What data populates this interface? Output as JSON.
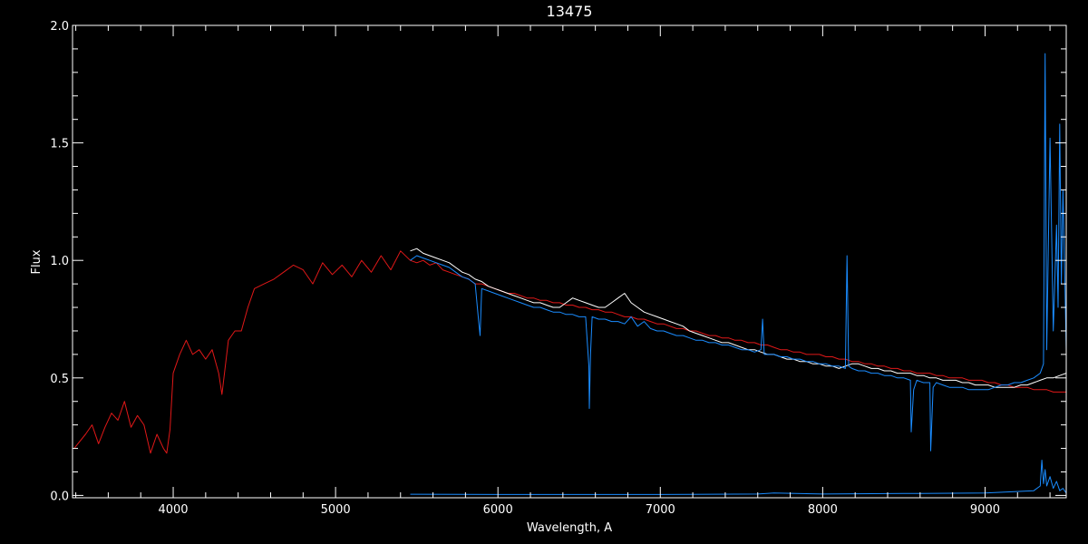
{
  "chart_data": {
    "type": "line",
    "title": "13475",
    "xlabel": "Wavelength, A",
    "ylabel": "Flux",
    "xlim": [
      3380,
      9500
    ],
    "ylim": [
      -0.01,
      2.0
    ],
    "grid": false,
    "legend": "none",
    "background": "#000000",
    "axis_color": "#ffffff",
    "x_ticks": [
      4000,
      5000,
      6000,
      7000,
      8000,
      9000
    ],
    "y_ticks": [
      0.0,
      0.5,
      1.0,
      1.5,
      2.0
    ],
    "x_tick_labels": [
      "4000",
      "5000",
      "6000",
      "7000",
      "8000",
      "9000"
    ],
    "y_tick_labels": [
      "0.0",
      "0.5",
      "1.0",
      "1.5",
      "2.0"
    ],
    "series": [
      {
        "color": "#e01818",
        "role": "model",
        "x": [
          3390,
          3460,
          3500,
          3540,
          3580,
          3620,
          3660,
          3700,
          3740,
          3780,
          3820,
          3860,
          3900,
          3940,
          3960,
          3980,
          4000,
          4040,
          4080,
          4120,
          4160,
          4200,
          4240,
          4280,
          4300,
          4340,
          4380,
          4420,
          4460,
          4500,
          4560,
          4620,
          4680,
          4740,
          4800,
          4860,
          4920,
          4980,
          5040,
          5100,
          5160,
          5220,
          5280,
          5340,
          5400,
          5460,
          5500,
          5540,
          5580,
          5620,
          5660,
          5700,
          5740,
          5780,
          5820,
          5860,
          5900,
          5940,
          5980,
          6020,
          6060,
          6100,
          6140,
          6180,
          6220,
          6260,
          6300,
          6340,
          6380,
          6420,
          6460,
          6500,
          6540,
          6580,
          6620,
          6660,
          6700,
          6740,
          6780,
          6820,
          6860,
          6900,
          6940,
          6980,
          7020,
          7060,
          7100,
          7140,
          7180,
          7220,
          7260,
          7300,
          7340,
          7380,
          7420,
          7460,
          7500,
          7540,
          7580,
          7620,
          7660,
          7700,
          7740,
          7780,
          7820,
          7860,
          7900,
          7940,
          7980,
          8020,
          8060,
          8100,
          8140,
          8180,
          8220,
          8260,
          8300,
          8340,
          8380,
          8420,
          8460,
          8500,
          8540,
          8580,
          8620,
          8660,
          8700,
          8740,
          8780,
          8820,
          8860,
          8900,
          8940,
          8980,
          9020,
          9060,
          9100,
          9140,
          9180,
          9220,
          9260,
          9300,
          9340,
          9380,
          9420,
          9460,
          9500
        ],
        "y": [
          0.2,
          0.26,
          0.3,
          0.22,
          0.29,
          0.35,
          0.32,
          0.4,
          0.29,
          0.34,
          0.3,
          0.18,
          0.26,
          0.2,
          0.18,
          0.28,
          0.52,
          0.6,
          0.66,
          0.6,
          0.62,
          0.58,
          0.62,
          0.52,
          0.43,
          0.66,
          0.7,
          0.7,
          0.8,
          0.88,
          0.9,
          0.92,
          0.95,
          0.98,
          0.96,
          0.9,
          0.99,
          0.94,
          0.98,
          0.93,
          1.0,
          0.95,
          1.02,
          0.96,
          1.04,
          1.0,
          0.99,
          1.0,
          0.98,
          0.99,
          0.96,
          0.95,
          0.94,
          0.93,
          0.92,
          0.9,
          0.9,
          0.89,
          0.88,
          0.87,
          0.86,
          0.86,
          0.85,
          0.84,
          0.84,
          0.83,
          0.83,
          0.82,
          0.82,
          0.81,
          0.81,
          0.8,
          0.8,
          0.79,
          0.79,
          0.78,
          0.78,
          0.77,
          0.76,
          0.76,
          0.75,
          0.75,
          0.74,
          0.73,
          0.73,
          0.72,
          0.71,
          0.71,
          0.7,
          0.7,
          0.69,
          0.68,
          0.68,
          0.67,
          0.67,
          0.66,
          0.66,
          0.65,
          0.65,
          0.64,
          0.64,
          0.63,
          0.62,
          0.62,
          0.61,
          0.61,
          0.6,
          0.6,
          0.6,
          0.59,
          0.59,
          0.58,
          0.58,
          0.57,
          0.57,
          0.56,
          0.56,
          0.55,
          0.55,
          0.54,
          0.54,
          0.53,
          0.53,
          0.52,
          0.52,
          0.52,
          0.51,
          0.51,
          0.5,
          0.5,
          0.5,
          0.49,
          0.49,
          0.49,
          0.48,
          0.48,
          0.47,
          0.47,
          0.46,
          0.46,
          0.46,
          0.45,
          0.45,
          0.45,
          0.44,
          0.44,
          0.44
        ]
      },
      {
        "color": "#ffffff",
        "role": "observed",
        "x": [
          5460,
          5500,
          5540,
          5580,
          5620,
          5660,
          5700,
          5740,
          5780,
          5820,
          5860,
          5900,
          5940,
          5980,
          6020,
          6060,
          6100,
          6140,
          6180,
          6220,
          6260,
          6300,
          6340,
          6380,
          6420,
          6460,
          6500,
          6540,
          6580,
          6620,
          6660,
          6700,
          6740,
          6780,
          6820,
          6860,
          6900,
          6940,
          6980,
          7020,
          7060,
          7100,
          7140,
          7180,
          7220,
          7260,
          7300,
          7340,
          7380,
          7420,
          7460,
          7500,
          7540,
          7580,
          7620,
          7660,
          7700,
          7740,
          7780,
          7820,
          7860,
          7900,
          7940,
          7980,
          8020,
          8060,
          8100,
          8140,
          8180,
          8220,
          8260,
          8300,
          8340,
          8380,
          8420,
          8460,
          8500,
          8540,
          8580,
          8620,
          8660,
          8700,
          8740,
          8780,
          8820,
          8860,
          8900,
          8940,
          8980,
          9020,
          9060,
          9100,
          9140,
          9180,
          9220,
          9260,
          9300,
          9340,
          9380,
          9420,
          9460,
          9500
        ],
        "y": [
          1.04,
          1.05,
          1.03,
          1.02,
          1.01,
          1.0,
          0.99,
          0.97,
          0.95,
          0.94,
          0.92,
          0.91,
          0.89,
          0.88,
          0.87,
          0.86,
          0.85,
          0.84,
          0.83,
          0.82,
          0.82,
          0.81,
          0.8,
          0.8,
          0.82,
          0.84,
          0.83,
          0.82,
          0.81,
          0.8,
          0.8,
          0.82,
          0.84,
          0.86,
          0.82,
          0.8,
          0.78,
          0.77,
          0.76,
          0.75,
          0.74,
          0.73,
          0.72,
          0.7,
          0.69,
          0.68,
          0.67,
          0.66,
          0.65,
          0.65,
          0.64,
          0.63,
          0.62,
          0.62,
          0.61,
          0.6,
          0.6,
          0.59,
          0.58,
          0.58,
          0.57,
          0.57,
          0.56,
          0.56,
          0.55,
          0.55,
          0.54,
          0.55,
          0.56,
          0.56,
          0.55,
          0.54,
          0.54,
          0.53,
          0.53,
          0.52,
          0.52,
          0.52,
          0.51,
          0.51,
          0.5,
          0.5,
          0.49,
          0.49,
          0.49,
          0.48,
          0.48,
          0.47,
          0.47,
          0.47,
          0.46,
          0.46,
          0.46,
          0.46,
          0.47,
          0.47,
          0.48,
          0.49,
          0.5,
          0.5,
          0.51,
          0.52
        ]
      },
      {
        "color": "#1a8cff",
        "role": "observed",
        "x": [
          5460,
          5500,
          5540,
          5580,
          5620,
          5660,
          5700,
          5740,
          5780,
          5820,
          5860,
          5880,
          5890,
          5900,
          5940,
          5980,
          6020,
          6060,
          6100,
          6140,
          6180,
          6220,
          6260,
          6300,
          6340,
          6380,
          6420,
          6460,
          6500,
          6540,
          6560,
          6563,
          6570,
          6580,
          6620,
          6660,
          6700,
          6740,
          6780,
          6820,
          6860,
          6900,
          6940,
          6980,
          7020,
          7060,
          7100,
          7140,
          7180,
          7220,
          7260,
          7300,
          7340,
          7380,
          7420,
          7460,
          7500,
          7540,
          7580,
          7620,
          7630,
          7640,
          7660,
          7700,
          7740,
          7780,
          7820,
          7860,
          7900,
          7940,
          7980,
          8020,
          8060,
          8100,
          8140,
          8150,
          8160,
          8180,
          8220,
          8260,
          8300,
          8340,
          8380,
          8420,
          8460,
          8500,
          8540,
          8545,
          8560,
          8580,
          8620,
          8660,
          8665,
          8680,
          8700,
          8740,
          8780,
          8820,
          8860,
          8900,
          8940,
          8980,
          9020,
          9060,
          9100,
          9140,
          9180,
          9220,
          9260,
          9300,
          9320,
          9340,
          9360,
          9370,
          9380,
          9400,
          9420,
          9440,
          9450,
          9460,
          9470,
          9480,
          9500
        ],
        "y": [
          1.0,
          1.02,
          1.01,
          1.0,
          0.99,
          0.98,
          0.97,
          0.95,
          0.93,
          0.92,
          0.9,
          0.75,
          0.68,
          0.88,
          0.87,
          0.86,
          0.85,
          0.84,
          0.83,
          0.82,
          0.81,
          0.8,
          0.8,
          0.79,
          0.78,
          0.78,
          0.77,
          0.77,
          0.76,
          0.76,
          0.55,
          0.37,
          0.6,
          0.76,
          0.75,
          0.75,
          0.74,
          0.74,
          0.73,
          0.76,
          0.72,
          0.74,
          0.71,
          0.7,
          0.7,
          0.69,
          0.68,
          0.68,
          0.67,
          0.66,
          0.66,
          0.65,
          0.65,
          0.64,
          0.64,
          0.63,
          0.62,
          0.62,
          0.61,
          0.62,
          0.75,
          0.6,
          0.6,
          0.6,
          0.59,
          0.59,
          0.58,
          0.58,
          0.57,
          0.57,
          0.56,
          0.56,
          0.55,
          0.55,
          0.54,
          1.02,
          0.55,
          0.54,
          0.53,
          0.53,
          0.52,
          0.52,
          0.51,
          0.51,
          0.5,
          0.5,
          0.49,
          0.27,
          0.45,
          0.49,
          0.48,
          0.48,
          0.19,
          0.46,
          0.48,
          0.47,
          0.46,
          0.46,
          0.46,
          0.45,
          0.45,
          0.45,
          0.45,
          0.46,
          0.47,
          0.47,
          0.48,
          0.48,
          0.49,
          0.5,
          0.51,
          0.52,
          0.56,
          1.88,
          0.62,
          1.52,
          0.7,
          1.15,
          0.8,
          1.58,
          0.9,
          1.3,
          0.62
        ]
      },
      {
        "color": "#1a8cff",
        "role": "error",
        "x": [
          5460,
          6000,
          7000,
          7600,
          7700,
          8000,
          8500,
          9000,
          9300,
          9340,
          9350,
          9360,
          9370,
          9380,
          9400,
          9420,
          9440,
          9460,
          9480,
          9500
        ],
        "y": [
          0.005,
          0.004,
          0.004,
          0.006,
          0.01,
          0.006,
          0.008,
          0.01,
          0.02,
          0.04,
          0.15,
          0.05,
          0.11,
          0.04,
          0.08,
          0.03,
          0.06,
          0.02,
          0.03,
          0.01
        ]
      }
    ]
  }
}
